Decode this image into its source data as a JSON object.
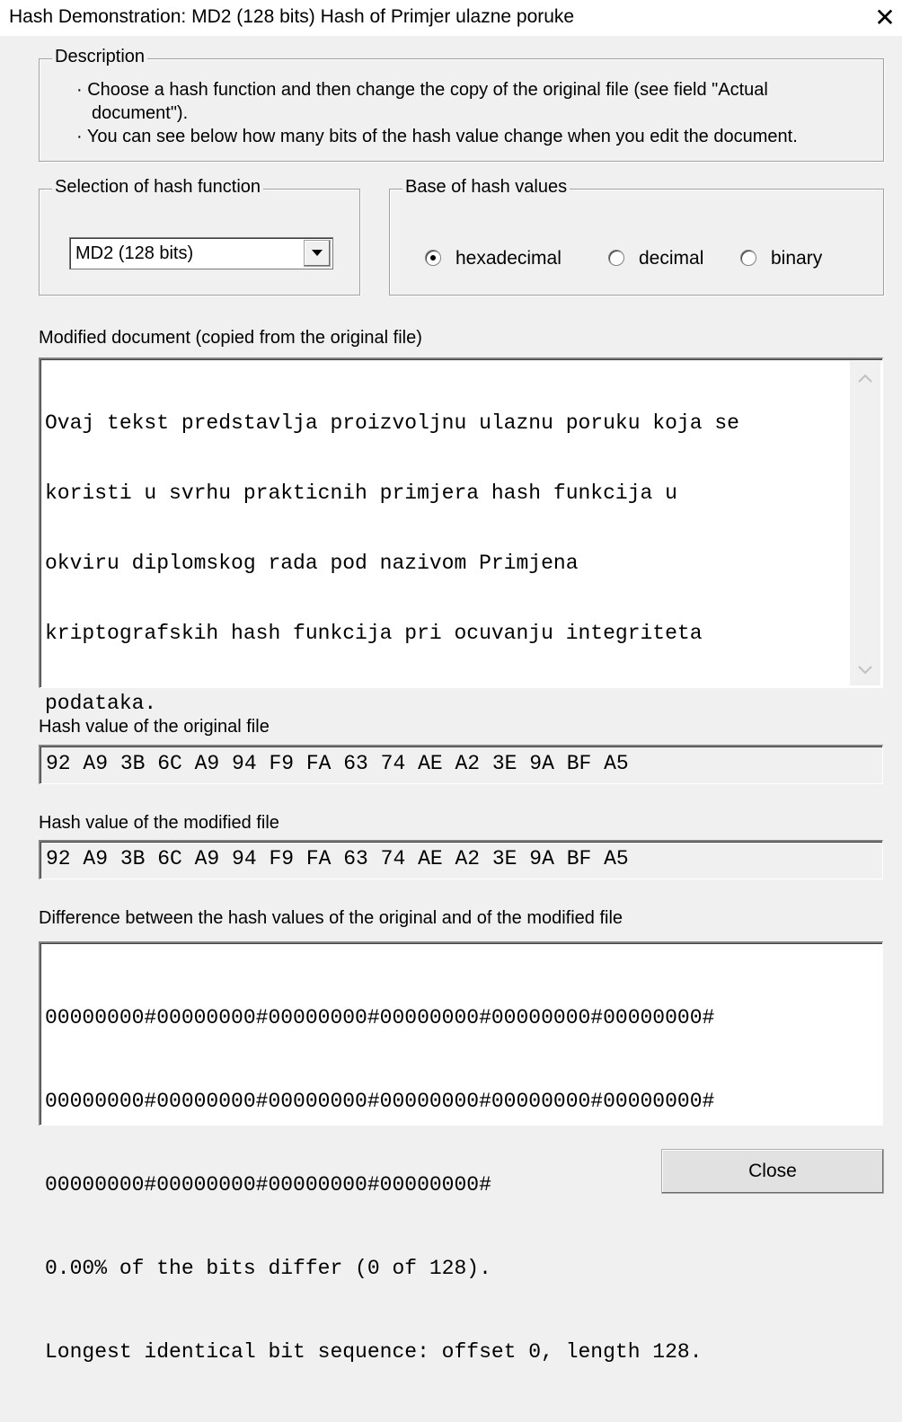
{
  "window": {
    "title": "Hash Demonstration: MD2 (128 bits) Hash of Primjer ulazne poruke",
    "close_glyph": "✕"
  },
  "description": {
    "legend": "Description",
    "lines": [
      "· Choose a hash function and then change the copy of the original file (see field \"Actual",
      "document\").",
      "· You can see below how many bits of the hash value change when you edit the document."
    ]
  },
  "hash_selection": {
    "legend": "Selection of hash function",
    "selected": "MD2 (128 bits)",
    "dropdown_icon": "chevron-down-icon"
  },
  "base": {
    "legend": "Base of hash values",
    "options": [
      {
        "label": "hexadecimal",
        "checked": true
      },
      {
        "label": "decimal",
        "checked": false
      },
      {
        "label": "binary",
        "checked": false
      }
    ]
  },
  "modified_document": {
    "label": "Modified document (copied from the original file)",
    "lines": [
      "Ovaj tekst predstavlja proizvoljnu ulaznu poruku koja se",
      "koristi u svrhu prakticnih primjera hash funkcija u",
      "okviru diplomskog rada pod nazivom Primjena",
      "kriptografskih hash funkcija pri ocuvanju integriteta",
      "podataka."
    ]
  },
  "original_hash": {
    "label": "Hash value of the original file",
    "value": "92 A9 3B 6C A9 94 F9 FA 63 74 AE A2 3E 9A BF A5"
  },
  "modified_hash": {
    "label": "Hash value of the modified file",
    "value": "92 A9 3B 6C A9 94 F9 FA 63 74 AE A2 3E 9A BF A5"
  },
  "difference": {
    "label": "Difference between the hash values of the original and of the modified file",
    "lines": [
      "00000000#00000000#00000000#00000000#00000000#00000000#",
      "00000000#00000000#00000000#00000000#00000000#00000000#",
      "00000000#00000000#00000000#00000000#",
      "0.00% of the bits differ (0 of 128).",
      "Longest identical bit sequence: offset 0, length 128."
    ]
  },
  "buttons": {
    "close": "Close"
  }
}
